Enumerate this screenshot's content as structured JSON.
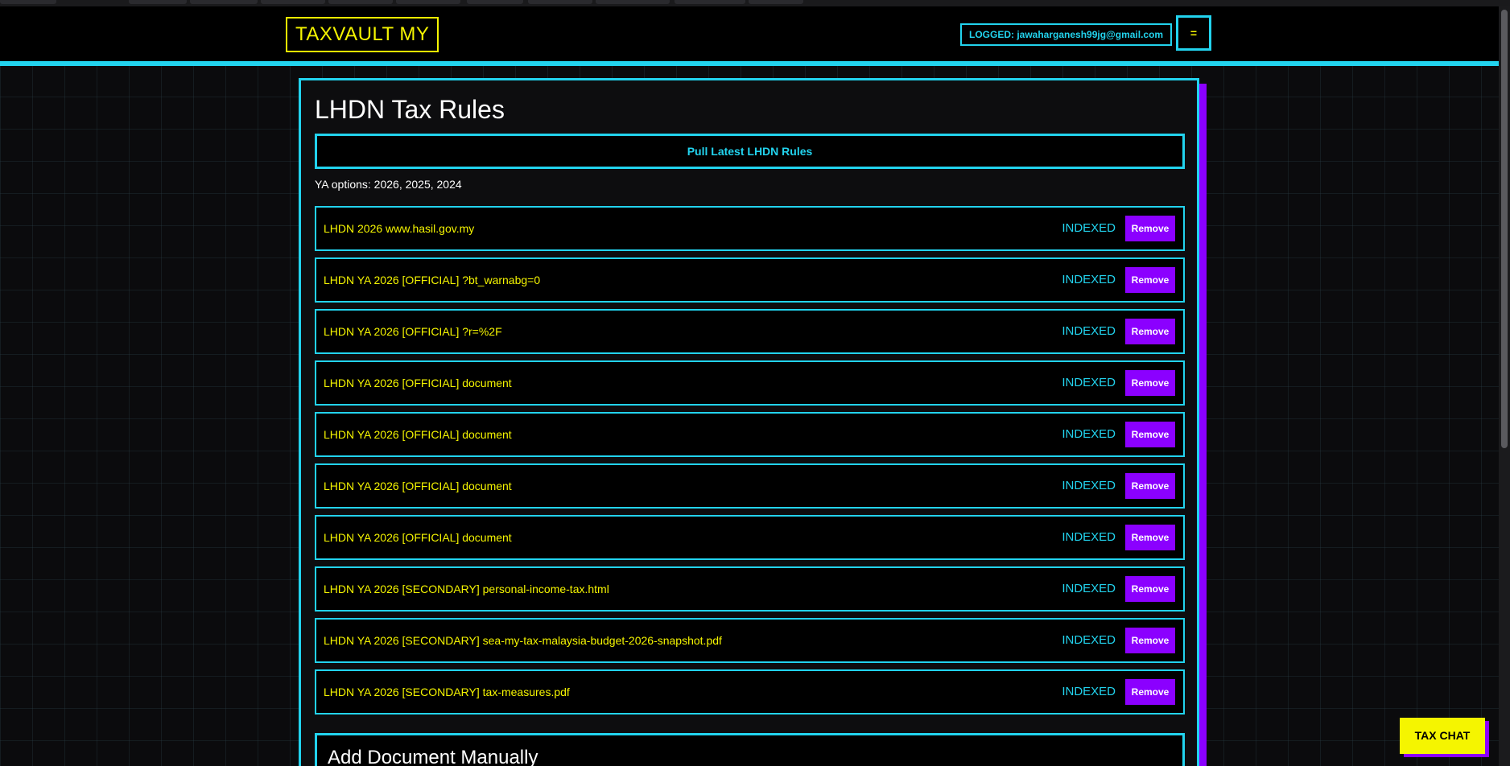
{
  "header": {
    "logo": "TAXVAULT MY",
    "logged_in": "LOGGED: jawaharganesh99jg@gmail.com",
    "menu_icon": "="
  },
  "main": {
    "title": "LHDN Tax Rules",
    "pull_button": "Pull Latest LHDN Rules",
    "ya_options": "YA options: 2026, 2025, 2024",
    "rules": [
      {
        "name": "LHDN 2026 www.hasil.gov.my",
        "status": "INDEXED",
        "action": "Remove"
      },
      {
        "name": "LHDN YA 2026 [OFFICIAL] ?bt_warnabg=0",
        "status": "INDEXED",
        "action": "Remove"
      },
      {
        "name": "LHDN YA 2026 [OFFICIAL] ?r=%2F",
        "status": "INDEXED",
        "action": "Remove"
      },
      {
        "name": "LHDN YA 2026 [OFFICIAL] document",
        "status": "INDEXED",
        "action": "Remove"
      },
      {
        "name": "LHDN YA 2026 [OFFICIAL] document",
        "status": "INDEXED",
        "action": "Remove"
      },
      {
        "name": "LHDN YA 2026 [OFFICIAL] document",
        "status": "INDEXED",
        "action": "Remove"
      },
      {
        "name": "LHDN YA 2026 [OFFICIAL] document",
        "status": "INDEXED",
        "action": "Remove"
      },
      {
        "name": "LHDN YA 2026 [SECONDARY] personal-income-tax.html",
        "status": "INDEXED",
        "action": "Remove"
      },
      {
        "name": "LHDN YA 2026 [SECONDARY] sea-my-tax-malaysia-budget-2026-snapshot.pdf",
        "status": "INDEXED",
        "action": "Remove"
      },
      {
        "name": "LHDN YA 2026 [SECONDARY] tax-measures.pdf",
        "status": "INDEXED",
        "action": "Remove"
      }
    ],
    "add_section_title": "Add Document Manually"
  },
  "chat": {
    "label": "TAX CHAT"
  },
  "colors": {
    "accent_cyan": "#22d3ee",
    "accent_yellow": "#f5f500",
    "accent_purple": "#8b00ff",
    "background": "#0b0b0d"
  }
}
